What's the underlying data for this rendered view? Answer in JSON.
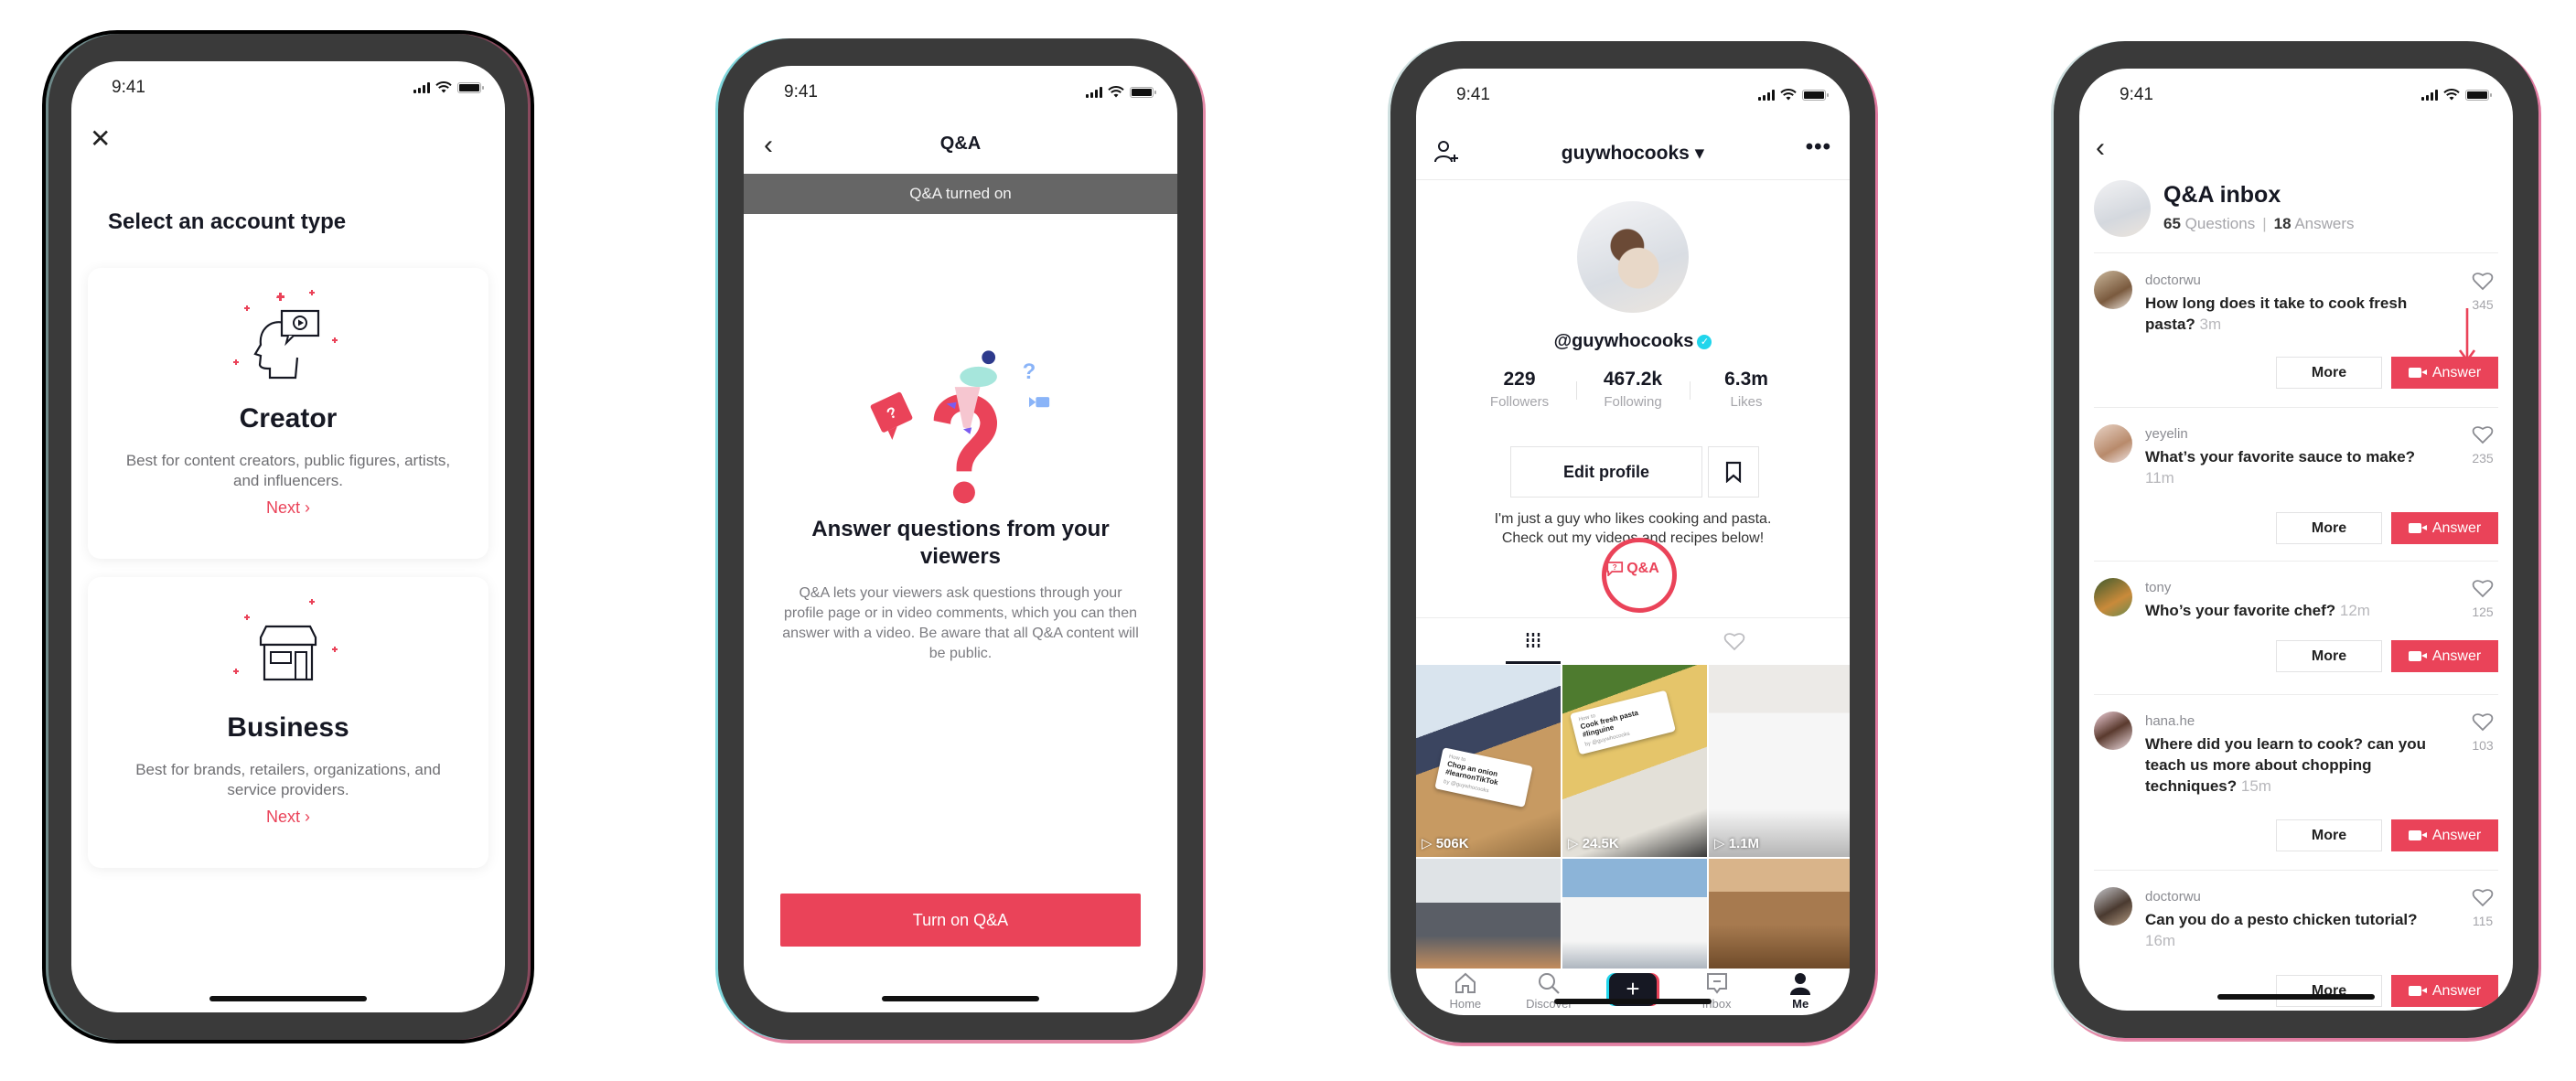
{
  "colors": {
    "brand_red": "#ea4359",
    "brand_cyan": "#20d5ec",
    "banner_gray": "#666666",
    "text_dark": "#161823"
  },
  "status_bar": {
    "time": "9:41"
  },
  "phone1": {
    "close_icon": "close-icon",
    "title": "Select an account type",
    "cards": [
      {
        "name": "Creator",
        "description": "Best for content creators, public figures, artists, and influencers.",
        "next_label": "Next ›",
        "icon": "creator-head-video-icon"
      },
      {
        "name": "Business",
        "description": "Best for brands, retailers, organizations, and service providers.",
        "next_label": "Next ›",
        "icon": "storefront-icon"
      }
    ]
  },
  "phone2": {
    "back_icon": "chevron-left-icon",
    "nav_title": "Q&A",
    "banner": "Q&A turned on",
    "headline": "Answer questions from your viewers",
    "body": "Q&A lets your viewers ask questions through your profile page or in video comments, which you can then answer with a video. Be aware that all Q&A content will be public.",
    "cta_label": "Turn on Q&A"
  },
  "phone3": {
    "username": "guywhocooks ▾",
    "handle": "@guywhocooks",
    "verified_mark": "✓",
    "stats": [
      {
        "value": "229",
        "label": "Followers"
      },
      {
        "value": "467.2k",
        "label": "Following"
      },
      {
        "value": "6.3m",
        "label": "Likes"
      }
    ],
    "edit_profile_label": "Edit profile",
    "bio_line1": "I'm just a guy who likes cooking and pasta.",
    "bio_line2": "Check out my videos and recipes below!",
    "qa_link_label": "Q&A",
    "videos": [
      {
        "views": "▷ 506K",
        "overlay_small": "How to",
        "overlay_title": "Chop an onion #learnonTikTok",
        "overlay_by": "by @guywhocooks"
      },
      {
        "views": "▷ 24.5K",
        "overlay_small": "How to",
        "overlay_title": "Cook fresh pasta #linguine",
        "overlay_by": "by @guywhocooks"
      },
      {
        "views": "▷ 1.1M"
      },
      {
        "views": ""
      },
      {
        "views": ""
      },
      {
        "views": ""
      }
    ],
    "tabbar": [
      {
        "label": "Home",
        "icon": "home-icon"
      },
      {
        "label": "Discover",
        "icon": "search-icon"
      },
      {
        "label": "+",
        "icon": "create-plus-icon"
      },
      {
        "label": "Inbox",
        "icon": "inbox-icon"
      },
      {
        "label": "Me",
        "icon": "profile-icon",
        "active": true
      }
    ]
  },
  "phone4": {
    "back_icon": "chevron-left-icon",
    "title": "Q&A inbox",
    "questions_count": "65",
    "questions_label": "Questions",
    "answers_count": "18",
    "answers_label": "Answers",
    "more_label": "More",
    "answer_label": "Answer",
    "questions": [
      {
        "user": "doctorwu",
        "text": "How long does it take to cook fresh pasta?",
        "time": "3m",
        "likes": "345"
      },
      {
        "user": "yeyelin",
        "text": "What’s your favorite sauce to make?",
        "time": "11m",
        "likes": "235"
      },
      {
        "user": "tony",
        "text": "Who’s your favorite chef?",
        "time": "12m",
        "likes": "125"
      },
      {
        "user": "hana.he",
        "text": "Where did you learn to cook? can you teach us more about chopping techniques?",
        "time": "15m",
        "likes": "103"
      },
      {
        "user": "doctorwu",
        "text": "Can you do a pesto chicken tutorial?",
        "time": "16m",
        "likes": "115"
      }
    ]
  }
}
